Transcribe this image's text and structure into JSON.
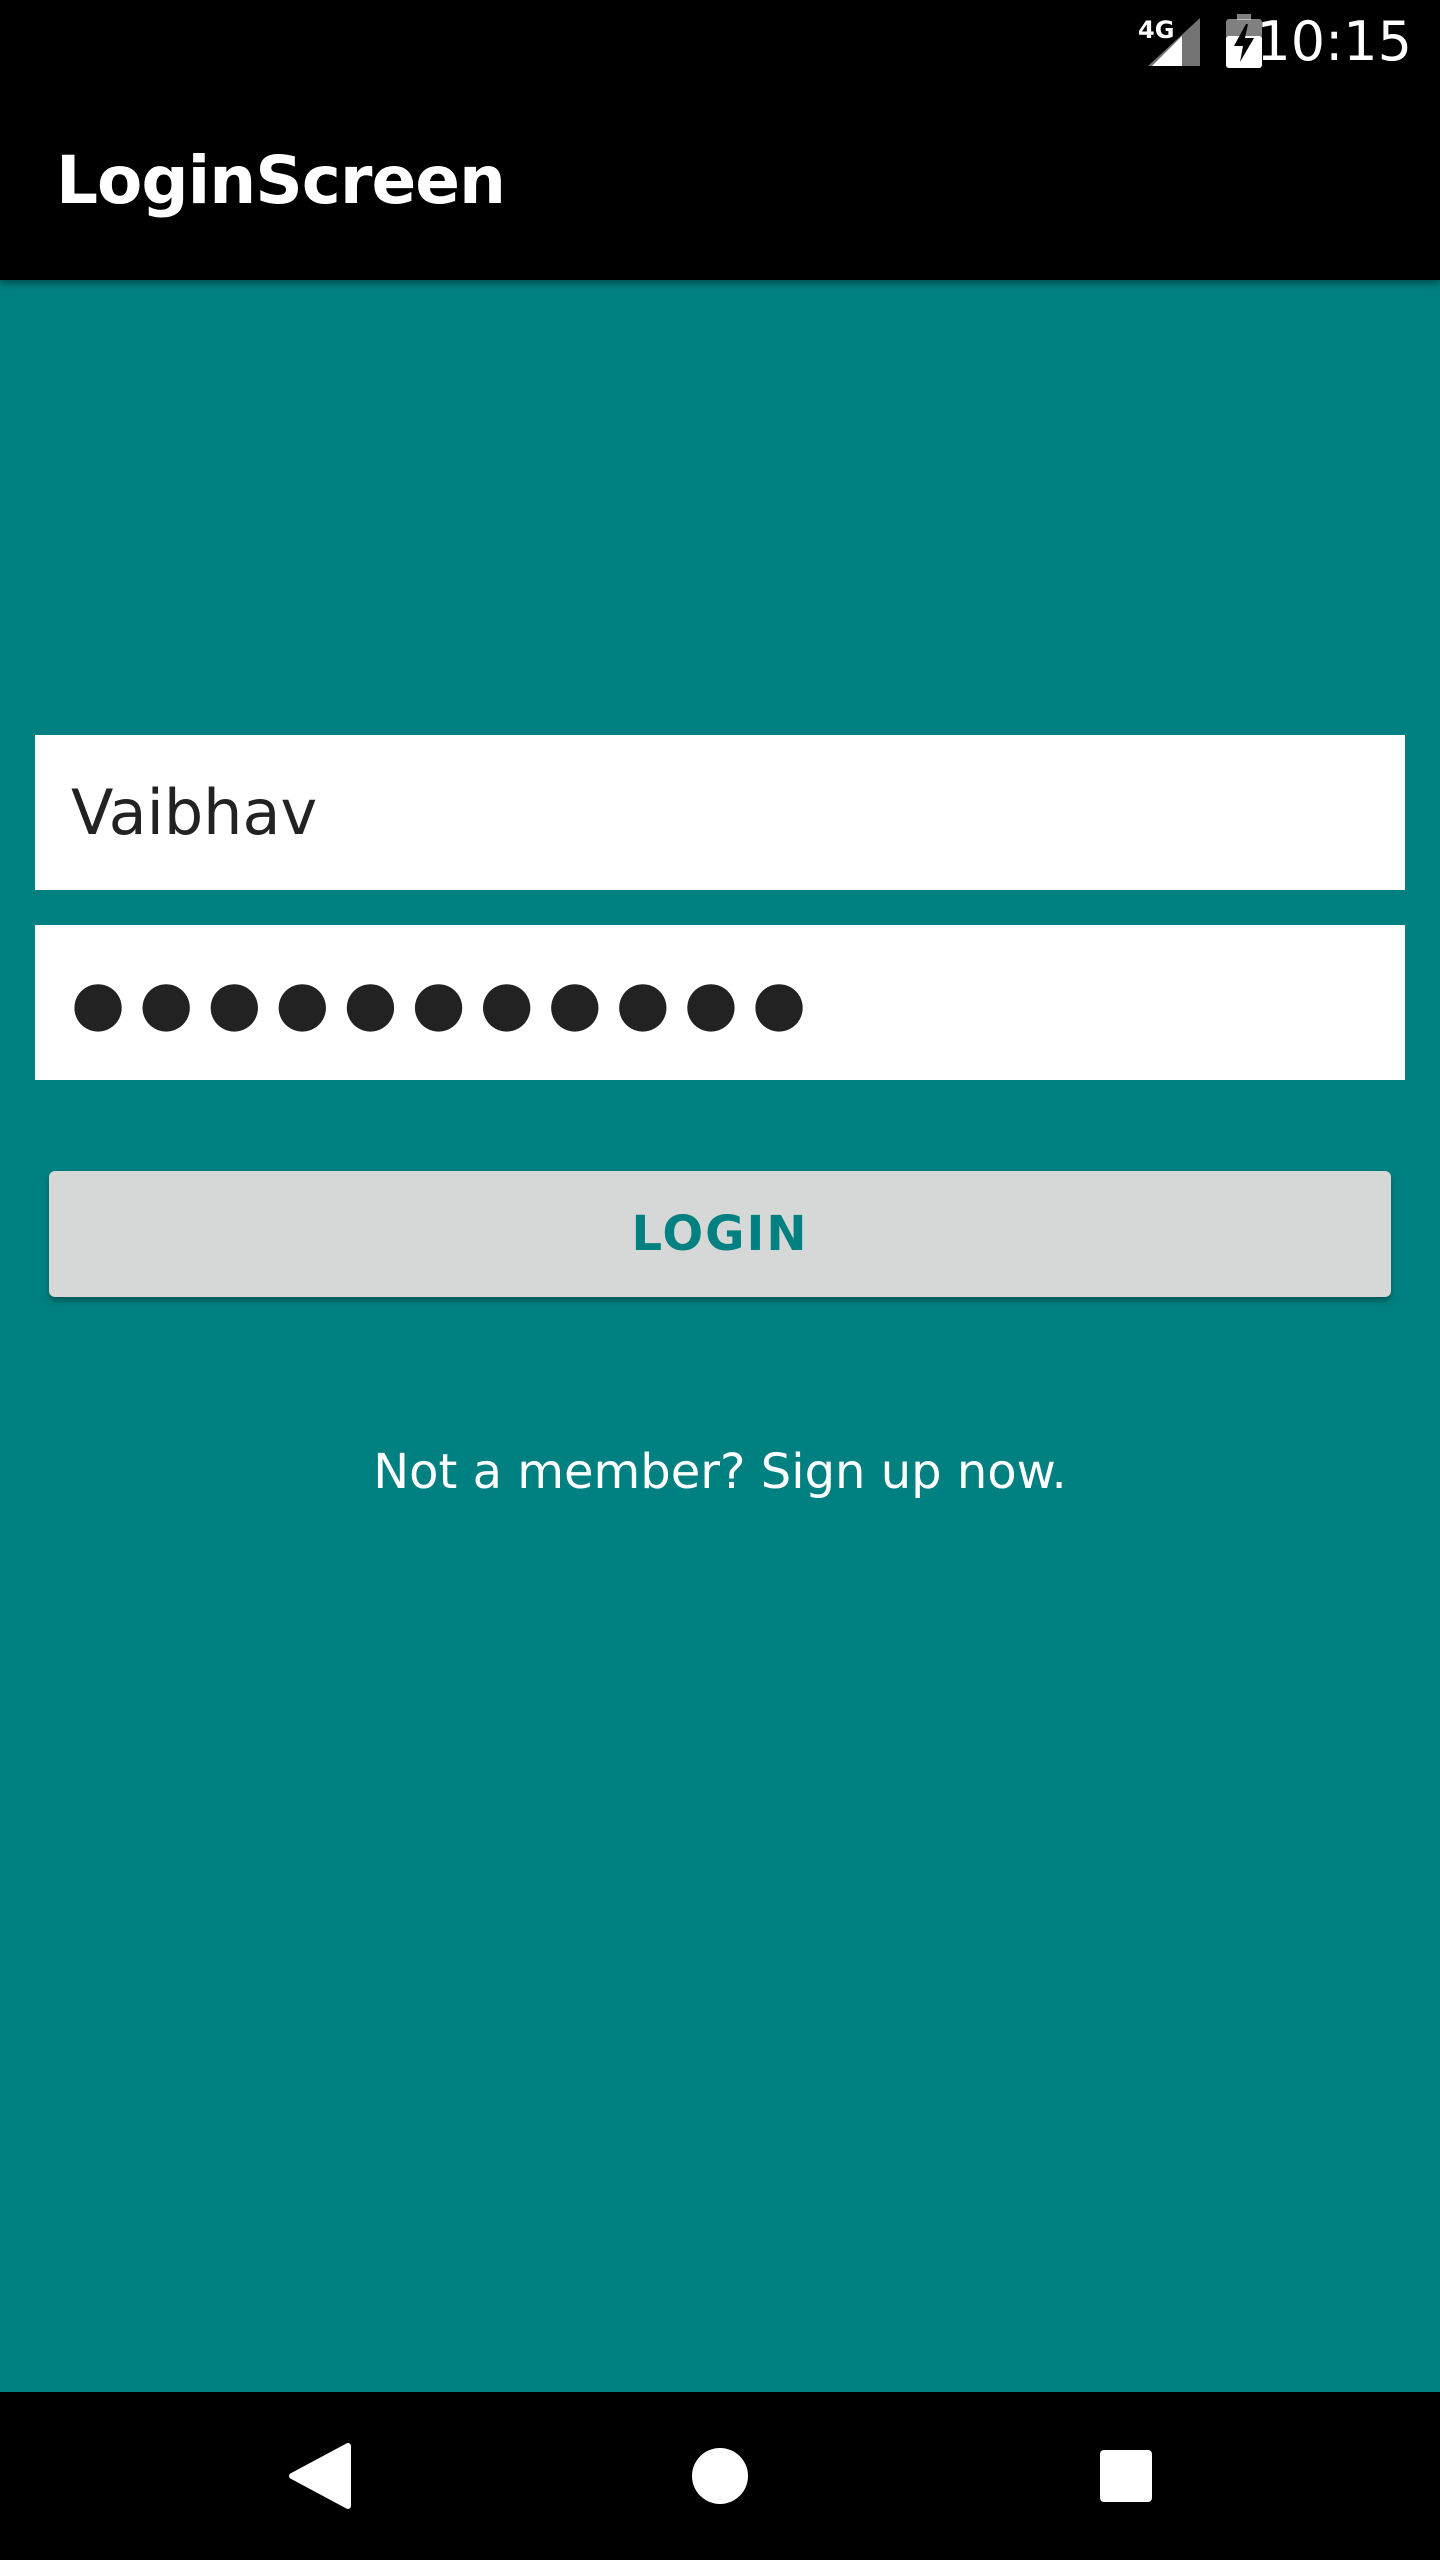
{
  "status_bar": {
    "network": "4G",
    "time": "10:15"
  },
  "app_bar": {
    "title": "LoginScreen"
  },
  "form": {
    "username_value": "Vaibhav",
    "password_value": "●●●●●●●●●●●",
    "login_label": "LOGIN",
    "signup_text": "Not a member? Sign up now."
  },
  "colors": {
    "background": "#008080",
    "app_bar": "#000000",
    "button": "#d6d7d7",
    "button_text": "#008080"
  },
  "icons": {
    "signal": "signal-icon",
    "battery": "battery-charging-icon",
    "back": "back-triangle-icon",
    "home": "home-circle-icon",
    "recents": "recents-square-icon"
  }
}
